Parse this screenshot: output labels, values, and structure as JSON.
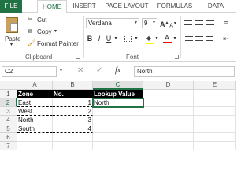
{
  "tabs": [
    "FILE",
    "HOME",
    "INSERT",
    "PAGE LAYOUT",
    "FORMULAS",
    "DATA"
  ],
  "clipboard": {
    "paste": "Paste",
    "cut": "Cut",
    "copy": "Copy",
    "format_painter": "Format Painter",
    "group_label": "Clipboard"
  },
  "font": {
    "name": "Verdana",
    "size": "9",
    "group_label": "Font",
    "bold": "B",
    "italic": "I",
    "underline": "U"
  },
  "formula_bar": {
    "name_box": "C2",
    "cancel": "✕",
    "enter": "✓",
    "fx": "fx",
    "content": "North"
  },
  "columns": [
    "A",
    "B",
    "C",
    "D",
    "E"
  ],
  "rows": [
    "1",
    "2",
    "3",
    "4",
    "5",
    "6",
    "7"
  ],
  "table": {
    "headers": [
      "Zone",
      "No.",
      "Lookup Value"
    ],
    "zones": [
      "East",
      "West",
      "North",
      "South"
    ],
    "numbers": [
      "1",
      "2",
      "3",
      "4"
    ],
    "lookup": "North"
  },
  "colors": {
    "accent": "#217346"
  }
}
